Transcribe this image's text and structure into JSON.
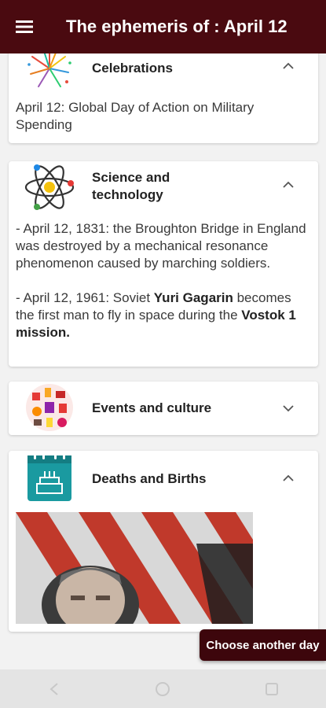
{
  "appbar": {
    "title": "The ephemeris of : April 12",
    "menu_icon": "hamburger-menu-icon"
  },
  "cards": {
    "celebrations": {
      "title": "Celebrations",
      "icon": "fireworks-icon",
      "expanded": true,
      "text": "April 12: Global Day of Action on Military Spending"
    },
    "science": {
      "title_line1": "Science and",
      "title_line2": "technology",
      "icon": "atom-icon",
      "expanded": true,
      "entry1": "- April 12, 1831: the Broughton Bridge in England was destroyed by a mechanical resonance phenomenon caused by marching soldiers.",
      "entry2_pre": " - April 12, 1961: Soviet ",
      "entry2_name": "Yuri Gagarin",
      "entry2_mid": " becomes the first man to fly in space during the ",
      "entry2_mission": "Vostok 1 mission."
    },
    "events": {
      "title": "Events and culture",
      "icon": "culture-collage-icon",
      "expanded": false
    },
    "deaths": {
      "title": "Deaths and Births",
      "icon": "birthday-calendar-icon",
      "expanded": true,
      "image": "portrait-with-flag-photo"
    }
  },
  "fab": {
    "label": "Choose another day"
  },
  "colors": {
    "appbar": "#4a0a10",
    "fab": "#3d060c",
    "background": "#f2f2f2",
    "calendar_teal": "#1a9aa0"
  }
}
